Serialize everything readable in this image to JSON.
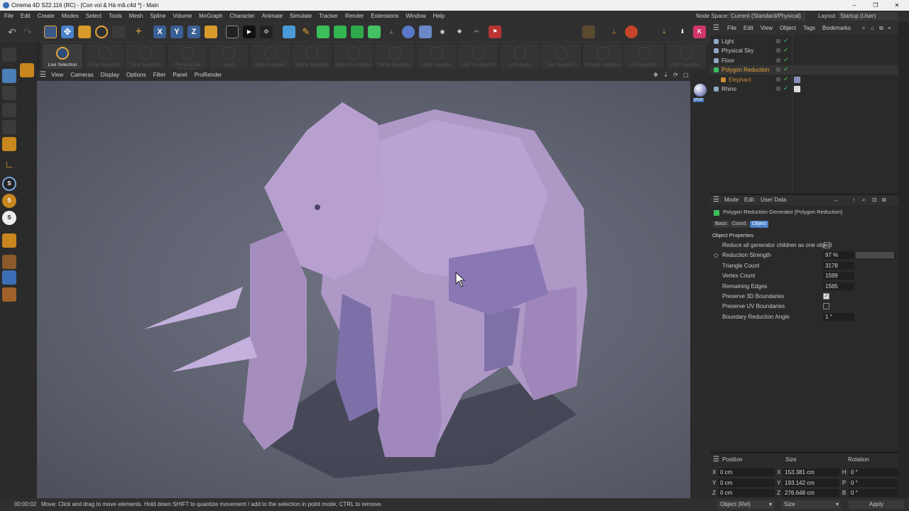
{
  "titlebar": {
    "title": "Cinema 4D S22.116 (RC) - [Con voi & Hà mã.c4d *] - Main"
  },
  "menubar": {
    "items": [
      "File",
      "Edit",
      "Create",
      "Modes",
      "Select",
      "Tools",
      "Mesh",
      "Spline",
      "Volume",
      "MoGraph",
      "Character",
      "Animate",
      "Simulate",
      "Tracker",
      "Render",
      "Extensions",
      "Window",
      "Help"
    ],
    "node_space_label": "Node Space:",
    "node_space_value": "Current (Standard/Physical)",
    "layout_label": "Layout:",
    "layout_value": "Startup (User)"
  },
  "modebar": {
    "buttons": [
      "Live Selection",
      "Loop Selection",
      "Ring Selection",
      "Phong Break Selection",
      "Invert",
      "Grow Selection",
      "Shrink Selection",
      "Select Connected",
      "Mirror Selection",
      "Hide Selected",
      "Hide Unselected",
      "Unhide All",
      "Set Selection",
      "Convert Selection",
      "Fill Selection",
      "Path Selection"
    ]
  },
  "viewport": {
    "menu": [
      "View",
      "Cameras",
      "Display",
      "Options",
      "Filter",
      "Panel",
      "ProRender"
    ],
    "side_label": "phon"
  },
  "objmgr": {
    "menu": [
      "File",
      "Edit",
      "View",
      "Object",
      "Tags",
      "Bookmarks"
    ],
    "objects": [
      {
        "name": "Light",
        "color": "#c8c8c8"
      },
      {
        "name": "Physical Sky",
        "color": "#c8c8c8"
      },
      {
        "name": "Floor",
        "color": "#c8c8c8"
      },
      {
        "name": "Polygon Reduction",
        "color": "#e8a33c"
      },
      {
        "name": "Elephant",
        "color": "#c98a32"
      },
      {
        "name": "Rhino",
        "color": "#c8c8c8"
      }
    ]
  },
  "attrmgr": {
    "menu": [
      "Mode",
      "Edit",
      "User Data"
    ],
    "header": "Polygon Reduction Generator [Polygon Reduction]",
    "tabs": [
      "Basic",
      "Coord.",
      "Object"
    ],
    "section": "Object Properties",
    "rows": [
      {
        "label": "Reduce all generator children as one object",
        "value": ""
      },
      {
        "label": "Reduction Strength",
        "value": "97 %"
      },
      {
        "label": "Triangle Count",
        "value": "3178"
      },
      {
        "label": "Vertex Count",
        "value": "1599"
      },
      {
        "label": "Remaining Edges",
        "value": "1585"
      },
      {
        "label": "Preserve 3D Boundaries",
        "value": ""
      },
      {
        "label": "Preserve UV Boundaries",
        "value": ""
      },
      {
        "label": "Boundary Reduction Angle",
        "value": "1 °"
      }
    ],
    "reduction_strength": 0.97,
    "preserve_3d": true,
    "preserve_uv": false,
    "reduce_all": false
  },
  "coordmgr": {
    "headers": [
      "Position",
      "Size",
      "Rotation"
    ],
    "rows": [
      {
        "axis": "X",
        "pos": "0 cm",
        "size_axis": "X",
        "size": "153.381 cm",
        "rot_axis": "H",
        "rot": "0 °"
      },
      {
        "axis": "Y",
        "pos": "0 cm",
        "size_axis": "Y",
        "size": "193.142 cm",
        "rot_axis": "P",
        "rot": "0 °"
      },
      {
        "axis": "Z",
        "pos": "0 cm",
        "size_axis": "Z",
        "size": "276.648 cm",
        "rot_axis": "B",
        "rot": "0 °"
      }
    ],
    "mode_value": "Object (Rel)",
    "size_mode_value": "Size",
    "apply_label": "Apply"
  },
  "statusbar": {
    "time": "00:00:02",
    "message": "Move: Click and drag to move elements. Hold down SHIFT to quantize movement / add to the selection in point mode, CTRL to remove."
  },
  "colors": {
    "accent_orange": "#e8a33c",
    "elephant": "#b79fc9",
    "active_blue": "#4a80c8"
  }
}
